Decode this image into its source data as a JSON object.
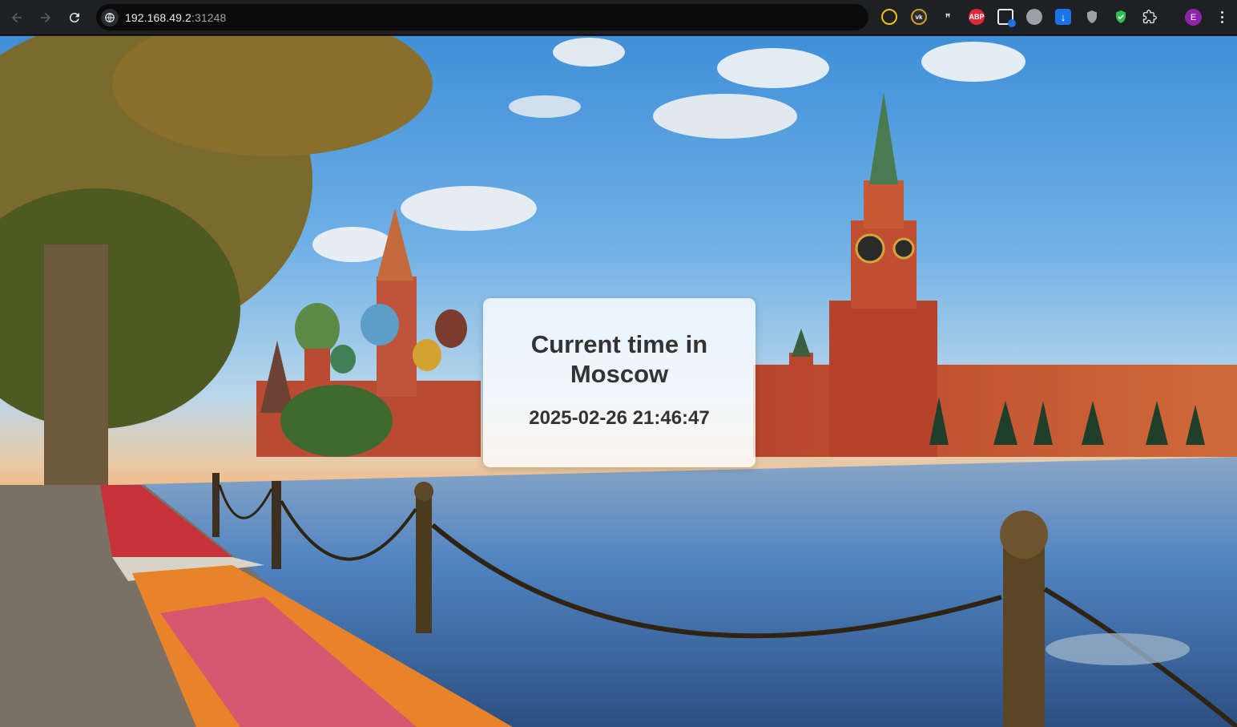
{
  "browser": {
    "url_host": "192.168.49.2",
    "url_port": ":31248",
    "extensions": [
      {
        "name": "extension-1-icon",
        "label": "",
        "color": "#f2c200"
      },
      {
        "name": "vk-extension-icon",
        "label": "",
        "color": "#2b2b2b"
      },
      {
        "name": "extension-3-icon",
        "label": "",
        "color": "#1f2023"
      },
      {
        "name": "adblock-plus-icon",
        "label": "ABP",
        "color": "#e0283a"
      },
      {
        "name": "window-extension-icon",
        "label": "",
        "color": "#1f2023"
      },
      {
        "name": "globe-extension-icon",
        "label": "",
        "color": "#9aa0a6"
      },
      {
        "name": "download-extension-icon",
        "label": "",
        "color": "#1a73e8"
      },
      {
        "name": "shield-extension-icon",
        "label": "",
        "color": "#9aa0a6"
      },
      {
        "name": "green-shield-extension-icon",
        "label": "",
        "color": "#2fbf4f"
      },
      {
        "name": "extensions-puzzle-icon",
        "label": "",
        "color": "#e8eaed"
      }
    ],
    "profile_initial": "E",
    "profile_color": "#8e24aa"
  },
  "page": {
    "title": "Current time in Moscow",
    "time": "2025-02-26 21:46:47"
  }
}
